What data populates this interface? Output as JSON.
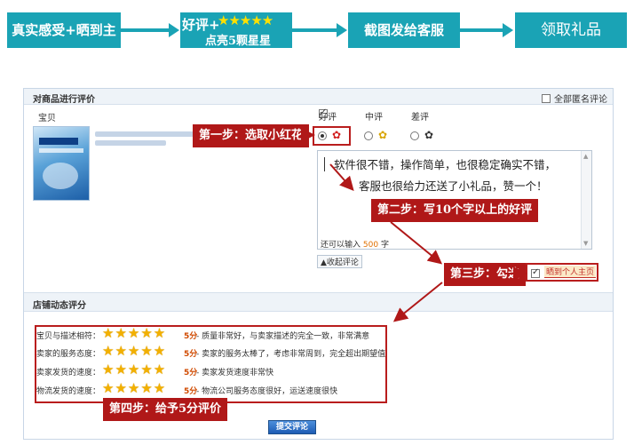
{
  "banner": {
    "step1": "真实感受+晒到主页",
    "step2_line1": "好评+",
    "step2_stars": "★★★★★",
    "step2_line2": "点亮5颗星星",
    "step3": "截图发给客服",
    "step4": "领取礼品"
  },
  "panel": {
    "title": "对商品进行评价",
    "anonymous_label": "全部匿名评论",
    "item_label": "宝贝",
    "rating_good": "好评",
    "rating_mid": "中评",
    "rating_bad": "差评",
    "review_line1": "软件很不错，操作简单，也很稳定确实不错，",
    "review_line2": "客服也很给力还送了小礼品，赞一个！",
    "remain_prefix": "还可以输入",
    "remain_count": "500",
    "remain_suffix": "字",
    "collapse_label": "▲收起评论",
    "show_label": "晒到个人主页"
  },
  "steps": {
    "s1": "第一步：选取小红花",
    "s2": "第二步：写10个字以上的好评",
    "s3": "第三步：勾选",
    "s4": "第四步：给予5分评价"
  },
  "shop": {
    "title": "店铺动态评分",
    "rows": [
      {
        "label": "宝贝与描述相符：",
        "stars": "★★★★★",
        "score": "5分",
        "desc": " - 质量非常好，与卖家描述的完全一致，非常满意"
      },
      {
        "label": "卖家的服务态度：",
        "stars": "★★★★★",
        "score": "5分",
        "desc": " - 卖家的服务太棒了，考虑非常周到，完全超出期望值"
      },
      {
        "label": "卖家发货的速度：",
        "stars": "★★★★★",
        "score": "5分",
        "desc": " - 卖家发货速度非常快"
      },
      {
        "label": "物流发货的速度：",
        "stars": "★★★★★",
        "score": "5分",
        "desc": " - 物流公司服务态度很好，运送速度很快"
      }
    ]
  },
  "submit_label": "提交评论",
  "colors": {
    "banner": "#1aa3b5",
    "step_label": "#b01818",
    "highlight": "#b91d1d",
    "star": "#f2b000"
  }
}
